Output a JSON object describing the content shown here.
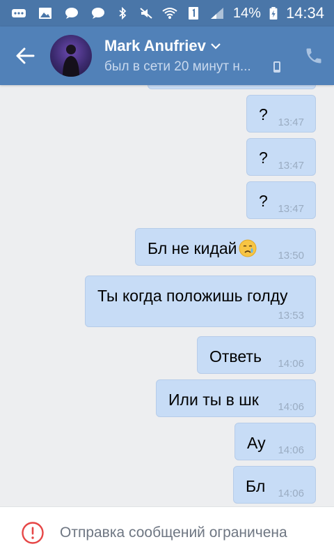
{
  "status_bar": {
    "battery": "14%",
    "time": "14:34",
    "notification_icons": [
      "more-icon",
      "image-icon",
      "chat-bubble-icon",
      "chat-bubble-icon"
    ],
    "system_icons": [
      "bluetooth-icon",
      "mute-icon",
      "wifi-icon",
      "sim-1-icon",
      "signal-icon",
      "battery-charging-icon"
    ]
  },
  "header": {
    "name": "Mark Anufriev",
    "status": "был в сети 20 минут н...",
    "icons": [
      "back-arrow-icon",
      "chevron-down-icon",
      "mobile-device-icon",
      "phone-icon"
    ]
  },
  "messages": [
    {
      "text": "?",
      "time": "13:47"
    },
    {
      "text": "?",
      "time": "13:47"
    },
    {
      "text": "?",
      "time": "13:47"
    },
    {
      "text": "Бл не кидай",
      "time": "13:50",
      "emoji": "crying-face-emoji"
    },
    {
      "text": "Ты когда положишь голду",
      "time": "13:53"
    },
    {
      "text": "Ответь",
      "time": "14:06"
    },
    {
      "text": "Или ты в шк",
      "time": "14:06"
    },
    {
      "text": "Ау",
      "time": "14:06"
    },
    {
      "text": "Бл",
      "time": "14:06"
    }
  ],
  "footer": {
    "text": "Отправка сообщений ограничена"
  },
  "colors": {
    "status_bar": "#4a76a8",
    "header": "#5181b8",
    "background": "#edeef0",
    "bubble": "#c7dcf6",
    "time_text": "#9aacc2",
    "warning": "#e64646"
  }
}
